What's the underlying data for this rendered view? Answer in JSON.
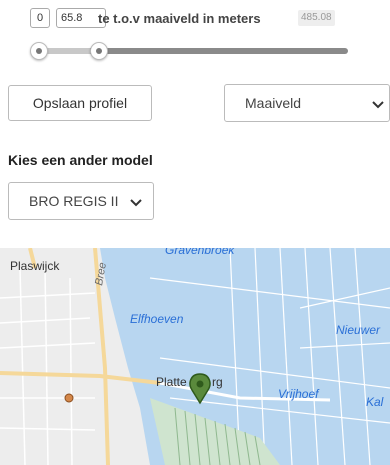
{
  "range": {
    "min_value": "0",
    "current_value": "65.8",
    "label": "te t.o.v maaiveld in meters",
    "max_value": "485.08",
    "selected_fraction_low": 0.0,
    "selected_fraction_high": 0.136
  },
  "buttons": {
    "save_profile": "Opslaan profiel"
  },
  "surface_select": {
    "value": "Maaiveld"
  },
  "model_section": {
    "title": "Kies een ander model",
    "selected_model": "BRO REGIS II"
  },
  "map": {
    "labels": {
      "plaswijck": "Plaswijck",
      "breeveld": "Bree",
      "gravenbroek": "Gravenbroek",
      "elfhoeven": "Elfhoeven",
      "nieuwer": "Nieuwer",
      "plattenburg_start": "Platte",
      "plattenburg_end": "rg",
      "vrijhoef": "Vrijhoef",
      "kal": "Kal"
    },
    "colors": {
      "water": "#b8d6f0",
      "land": "#ededed",
      "road_yellow": "#f5d89a",
      "marker": "#5a8a3c",
      "poi": "#d4874a"
    }
  },
  "icons": {
    "chevron": "chevron-down-icon",
    "marker": "map-marker-icon",
    "poi": "poi-dot-icon"
  }
}
